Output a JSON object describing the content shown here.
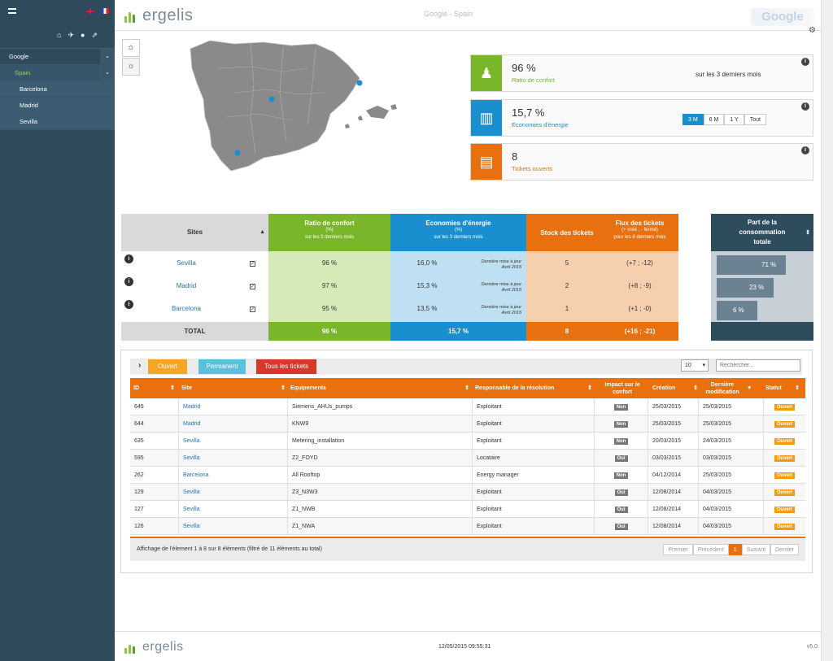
{
  "sidebar": {
    "quick_icons": [
      "home-icon",
      "plane-icon",
      "user-icon",
      "logout-icon"
    ],
    "items": [
      {
        "label": "Google",
        "level": "group"
      },
      {
        "label": "Spain",
        "level": "country"
      },
      {
        "label": "Barcelona",
        "level": "city"
      },
      {
        "label": "Madrid",
        "level": "city"
      },
      {
        "label": "Sevilla",
        "level": "city"
      }
    ]
  },
  "header": {
    "brand": "ergelis",
    "window_title": "Google - Spain",
    "badge": "Google"
  },
  "kpis": {
    "comfort": {
      "value": "96 %",
      "label": "Ratio de confort",
      "note": "sur les 3 derniers mois",
      "color": "#7ab62a"
    },
    "energy": {
      "value": "15,7 %",
      "label": "Economies d'énergie",
      "color": "#1a8fd0",
      "periods": [
        "3 M",
        "6 M",
        "1 Y",
        "Tout"
      ],
      "active_period": "3 M"
    },
    "tickets": {
      "value": "8",
      "label": "Tickets ouverts",
      "color": "#e8700f"
    }
  },
  "sites_table": {
    "headers": {
      "sites": "Sites",
      "comfort": "Ratio de confort",
      "comfort_unit": "(%)",
      "comfort_sub": "sur les 3 derniers mois",
      "energy": "Economies d'énergie",
      "energy_unit": "(%)",
      "energy_sub": "sur les 3 derniers mois",
      "stock": "Stock des tickets",
      "flux": "Flux des tickets",
      "flux_unit": "(+ créé ; - fermé)",
      "flux_sub": "pour les 6 derniers mois",
      "share": "Part de la consommation totale"
    },
    "rows": [
      {
        "site": "Sevilla",
        "comfort": "96 %",
        "energy": "16,0 %",
        "note1": "Dernière mise à jour",
        "note2": "Avril 2015",
        "stock": "5",
        "flux": "(+7 ; -12)",
        "share": "71 %",
        "share_value": 0.71
      },
      {
        "site": "Madrid",
        "comfort": "97 %",
        "energy": "15,3 %",
        "note1": "Dernière mise à jour",
        "note2": "Avril 2015",
        "stock": "2",
        "flux": "(+8 ; -9)",
        "share": "23 %",
        "share_value": 0.23
      },
      {
        "site": "Barcelona",
        "comfort": "95 %",
        "energy": "13,5 %",
        "note1": "Dernière mise à jour",
        "note2": "Avril 2015",
        "stock": "1",
        "flux": "(+1 ; -0)",
        "share": "6 %",
        "share_value": 0.06
      }
    ],
    "total": {
      "label": "TOTAL",
      "comfort": "96 %",
      "energy": "15,7 %",
      "stock": "8",
      "flux": "(+16 ; -21)"
    }
  },
  "tickets": {
    "filters": [
      "Ouvert",
      "Permanent",
      "Tous les tickets"
    ],
    "filter_colors": [
      "#f5a623",
      "#5bc0de",
      "#d9372a"
    ],
    "per_page": "10",
    "search_placeholder": "Rechercher...",
    "columns": [
      "ID",
      "Site",
      "Equipements",
      "Responsable de la résolution",
      "Impact sur le confort",
      "Création",
      "Dernière modification",
      "Statut"
    ],
    "rows": [
      {
        "id": "645",
        "site": "Madrid",
        "equip": "Siemens_AHUs_pumps",
        "resp": "Exploitant",
        "impact": "Non",
        "created": "25/03/2015",
        "modified": "25/03/2015",
        "status": "Ouvert"
      },
      {
        "id": "644",
        "site": "Madrid",
        "equip": "KNW9",
        "resp": "Exploitant",
        "impact": "Non",
        "created": "25/03/2015",
        "modified": "25/03/2015",
        "status": "Ouvert"
      },
      {
        "id": "635",
        "site": "Sevilla",
        "equip": "Metering_installation",
        "resp": "Exploitant",
        "impact": "Non",
        "created": "20/03/2015",
        "modified": "24/03/2015",
        "status": "Ouvert"
      },
      {
        "id": "595",
        "site": "Sevilla",
        "equip": "Z2_FOYD",
        "resp": "Locataire",
        "impact": "Oui",
        "created": "03/03/2015",
        "modified": "03/03/2015",
        "status": "Ouvert"
      },
      {
        "id": "262",
        "site": "Barcelona",
        "equip": "All Rooftop",
        "resp": "Energy manager",
        "impact": "Non",
        "created": "04/12/2014",
        "modified": "25/03/2015",
        "status": "Ouvert"
      },
      {
        "id": "129",
        "site": "Sevilla",
        "equip": "Z3_N3W3",
        "resp": "Exploitant",
        "impact": "Oui",
        "created": "12/08/2014",
        "modified": "04/03/2015",
        "status": "Ouvert"
      },
      {
        "id": "127",
        "site": "Sevilla",
        "equip": "Z1_NWB",
        "resp": "Exploitant",
        "impact": "Oui",
        "created": "12/08/2014",
        "modified": "04/03/2015",
        "status": "Ouvert"
      },
      {
        "id": "126",
        "site": "Sevilla",
        "equip": "Z1_NWA",
        "resp": "Exploitant",
        "impact": "Oui",
        "created": "12/08/2014",
        "modified": "04/03/2015",
        "status": "Ouvert"
      }
    ],
    "footer_info": "Affichage de l'élement 1 à 8 sur 8 éléments (filtré de 11 éléments au total)",
    "pager": [
      "Premier",
      "Précédent",
      "1",
      "Suivant",
      "Dernier"
    ]
  },
  "footer": {
    "brand": "ergelis",
    "timestamp": "12/05/2015 09:55:31",
    "version": "v5.0"
  }
}
